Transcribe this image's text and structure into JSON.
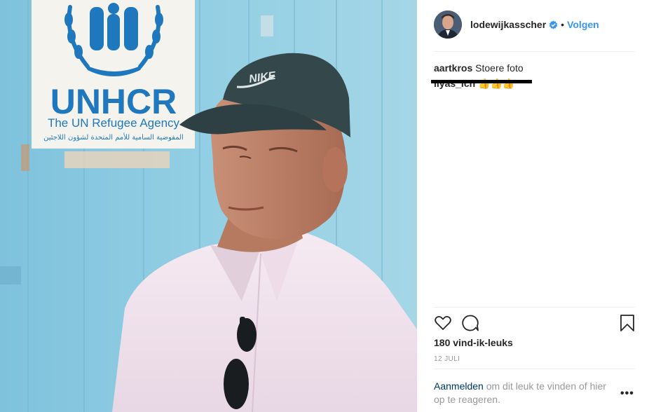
{
  "photo": {
    "sign_title": "UNHCR",
    "sign_subtitle": "The UN Refugee Agency",
    "sign_arabic": "المفوضية السامية للأمم المتحدة لشؤون اللاجئين",
    "cap_logo": "NIKE"
  },
  "header": {
    "username": "lodewijkasscher",
    "verified_icon": "verified-badge-icon",
    "separator": "•",
    "follow_label": "Volgen"
  },
  "comments": [
    {
      "user": "aartkros",
      "text": "Stoere foto"
    },
    {
      "user": "ilyas_ich",
      "text": "👍👍👍"
    }
  ],
  "actions": {
    "like_icon": "heart-icon",
    "comment_icon": "comment-icon",
    "save_icon": "bookmark-icon"
  },
  "likes_label": "180 vind-ik-leuks",
  "date_label": "12 JULI",
  "login": {
    "link_label": "Aanmelden",
    "rest_text": " om dit leuk te vinden of hier op te reageren."
  },
  "more_label": "•••",
  "colors": {
    "follow_blue": "#3897f0",
    "link_blue": "#003569",
    "verified_blue": "#3897f0",
    "unhcr_blue": "#1f78bd",
    "wall_blue": "#8ccbe2",
    "muted_text": "#999999"
  }
}
